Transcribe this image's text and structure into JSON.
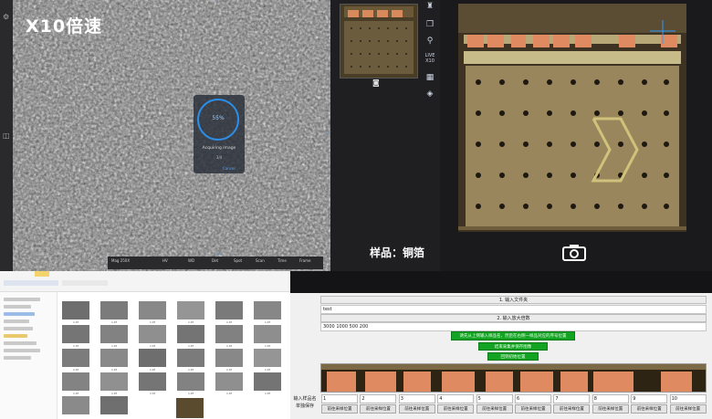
{
  "sem_view": {
    "title": "X10倍速",
    "acquire_percent": "55%",
    "acquire_label": "Acquiring image",
    "acquire_sub": "3/4",
    "acquire_link": "Cancel",
    "bar_items": [
      "Mag 250X",
      "HV",
      "WD",
      "Det",
      "Spot",
      "Scan",
      "Time",
      "Frame"
    ]
  },
  "side_toolbar": {
    "live_label_1": "LIVE",
    "live_label_2": "X10"
  },
  "sample_label": "样品：铜箔",
  "app": {
    "section1_label": "1. 输入文件夹",
    "folder_value": "test",
    "section2_label": "2. 输入放大倍数",
    "magnification_value": "3000 1000 500 200",
    "green_button_1": "请先从上侧输入样品名，然后在右侧一样品对应的序号位置",
    "green_button_2": "结束采集并保存图像",
    "green_button_3": "回到初始位置",
    "sample_name_label": "输入样品名",
    "sample_name_label_2": "单独保存",
    "slots": [
      {
        "num": "1",
        "btn": "前往采样位置"
      },
      {
        "num": "2",
        "btn": "前往采样位置"
      },
      {
        "num": "3",
        "btn": "前往采样位置"
      },
      {
        "num": "4",
        "btn": "前往采样位置"
      },
      {
        "num": "5",
        "btn": "前往采样位置"
      },
      {
        "num": "6",
        "btn": "前往采样位置"
      },
      {
        "num": "7",
        "btn": "前往采样位置"
      },
      {
        "num": "8",
        "btn": "前往采样位置"
      },
      {
        "num": "9",
        "btn": "前往采样位置"
      },
      {
        "num": "10",
        "btn": "前往采样位置"
      }
    ]
  },
  "explorer": {
    "thumb_caption": "1.tif"
  },
  "colors": {
    "accent_blue": "#2b8ee8",
    "green_button": "#11a321",
    "copper": "#d98a5c"
  }
}
